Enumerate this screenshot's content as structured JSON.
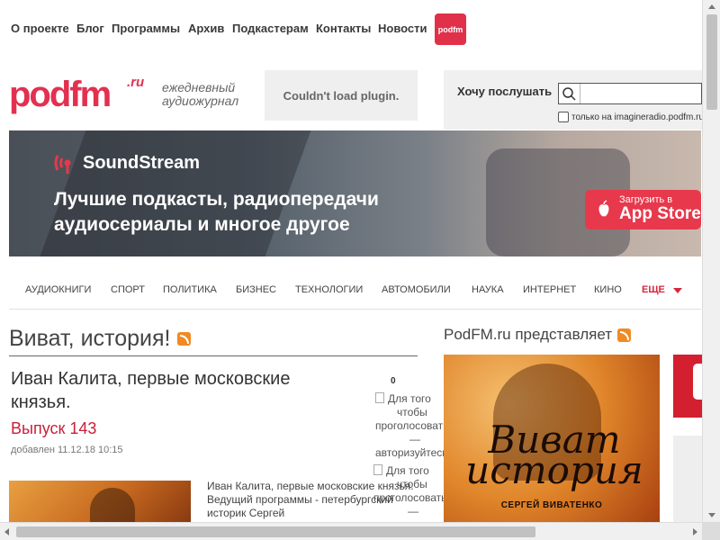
{
  "topnav": {
    "items": [
      "О проекте",
      "Блог",
      "Программы",
      "Архив",
      "Подкастерам",
      "Контакты",
      "Новости"
    ],
    "logo_small": "podfm"
  },
  "header": {
    "logo_main": "podfm",
    "logo_ru": ".ru",
    "tagline_1": "ежедневный",
    "tagline_2": "аудиожурнал",
    "plugin_message": "Couldn't load plugin.",
    "listen_label": "Хочу послушать",
    "search_value": "",
    "only_imagine_label": "только на imagineradio.podfm.ru"
  },
  "banner": {
    "brand": "SoundStream",
    "headline_1": "Лучшие подкасты, радиопередачи",
    "headline_2": "аудиосериалы и многое другое",
    "appstore_small": "Загрузить в",
    "appstore_big": "App Store"
  },
  "categories": {
    "items": [
      "АУДИОКНИГИ",
      "СПОРТ",
      "ПОЛИТИКА",
      "БИЗНЕС",
      "ТЕХНОЛОГИИ",
      "АВТОМОБИЛИ",
      "НАУКА",
      "ИНТЕРНЕТ",
      "КИНО"
    ],
    "more": "ЕЩЕ"
  },
  "main": {
    "section_title": "Виват, история!",
    "episode_title": "Иван Калита, первые московские князья.",
    "episode_number": "Выпуск 143",
    "episode_date": "добавлен 11.12.18 10:15",
    "vote_count": "0",
    "vote_up_text_1": "Для того",
    "vote_up_text_2": "чтобы",
    "vote_up_text_3": "проголосовать",
    "vote_up_text_4": "—",
    "vote_up_text_5": "авторизуйтесь",
    "vote_down_text_1": "Для того",
    "vote_down_text_2": "чтобы",
    "vote_down_text_3": "проголосовать",
    "vote_down_text_4": "—",
    "description": "Иван Калита, первые московские князья. Ведущий программы - петербургский историк Сергей"
  },
  "sidebar": {
    "title": "PodFM.ru представляет",
    "promo_title_1": "Виват",
    "promo_title_2": "история",
    "promo_author": "СЕРГЕЙ ВИВАТЕНКО"
  },
  "colors": {
    "brand_red": "#e33050",
    "link_red": "#c8203a",
    "rss_orange": "#f08a24"
  }
}
